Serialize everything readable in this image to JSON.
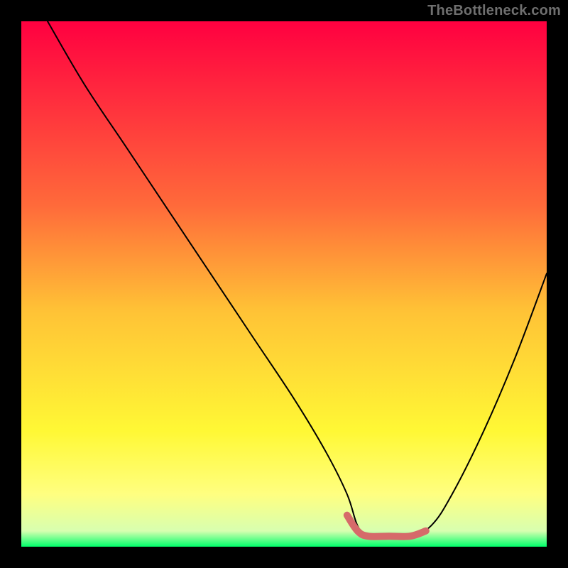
{
  "watermark": {
    "text": "TheBottleneck.com"
  },
  "chart_data": {
    "type": "line",
    "title": "",
    "xlabel": "",
    "ylabel": "",
    "xlim": [
      0,
      100
    ],
    "ylim": [
      0,
      100
    ],
    "background": {
      "type": "vertical-gradient",
      "stops": [
        {
          "pos": 0.0,
          "color": "#ff0040"
        },
        {
          "pos": 0.35,
          "color": "#ff6a3a"
        },
        {
          "pos": 0.55,
          "color": "#ffc236"
        },
        {
          "pos": 0.78,
          "color": "#fff835"
        },
        {
          "pos": 0.9,
          "color": "#ffff80"
        },
        {
          "pos": 0.97,
          "color": "#d8ffb0"
        },
        {
          "pos": 1.0,
          "color": "#00ff6a"
        }
      ]
    },
    "series": [
      {
        "name": "bottleneck-curve",
        "color": "#000000",
        "width": 2,
        "x": [
          5,
          12,
          20,
          28,
          36,
          44,
          52,
          58,
          62,
          64,
          66,
          70,
          74,
          78,
          82,
          88,
          94,
          100
        ],
        "y": [
          100,
          88,
          76,
          64,
          52,
          40,
          28,
          18,
          10,
          4,
          2,
          2,
          2,
          4,
          10,
          22,
          36,
          52
        ]
      }
    ],
    "highlight": {
      "name": "sweet-spot",
      "color": "#d66a6a",
      "width": 10,
      "x": [
        62,
        64,
        66,
        70,
        74,
        77
      ],
      "y": [
        6,
        3,
        2,
        2,
        2,
        3
      ]
    }
  }
}
